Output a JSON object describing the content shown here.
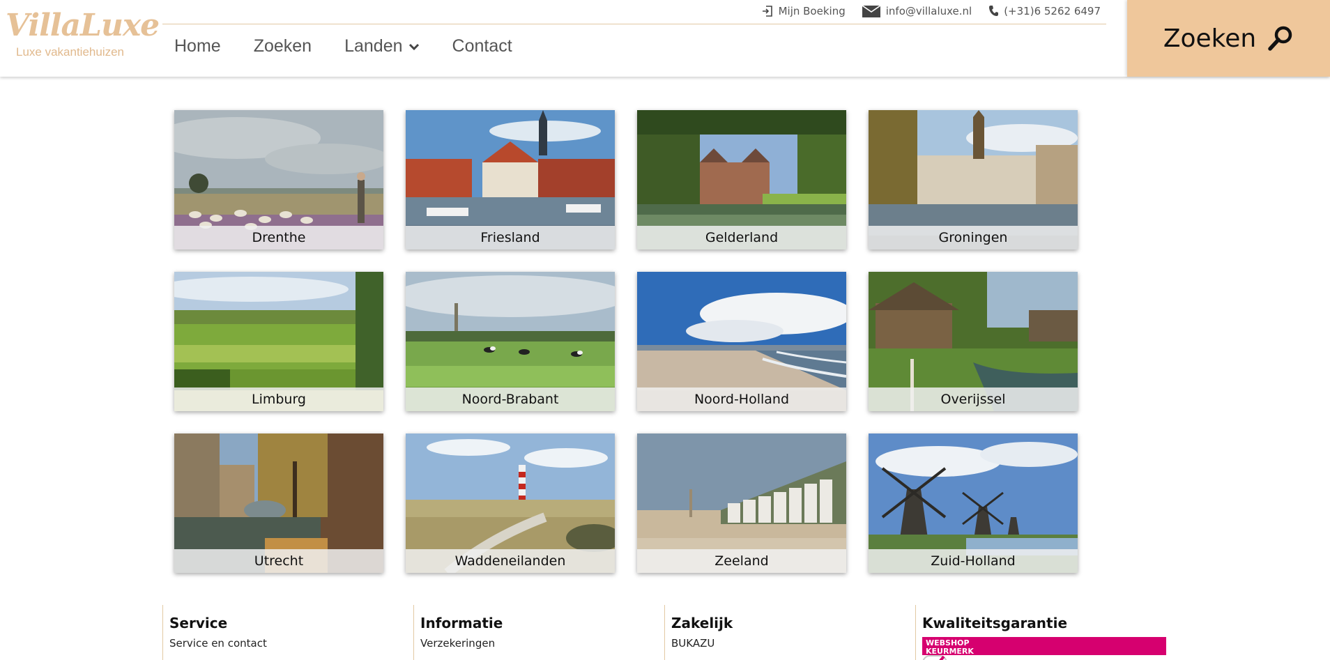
{
  "brand": {
    "logo_text": "VillaLuxe",
    "tagline": "Luxe vakantiehuizen",
    "accent_color": "#efc79b",
    "logo_color": "#e6c197"
  },
  "topbar": {
    "booking": "Mijn Boeking",
    "email": "info@villaluxe.nl",
    "phone": "(+31)6 5262 6497"
  },
  "nav": {
    "items": [
      {
        "label": "Home"
      },
      {
        "label": "Zoeken"
      },
      {
        "label": "Landen"
      },
      {
        "label": "Contact"
      }
    ]
  },
  "search_button": {
    "label": "Zoeken"
  },
  "regions": [
    {
      "label": "Drenthe"
    },
    {
      "label": "Friesland"
    },
    {
      "label": "Gelderland"
    },
    {
      "label": "Groningen"
    },
    {
      "label": "Limburg"
    },
    {
      "label": "Noord-Brabant"
    },
    {
      "label": "Noord-Holland"
    },
    {
      "label": "Overijssel"
    },
    {
      "label": "Utrecht"
    },
    {
      "label": "Waddeneilanden"
    },
    {
      "label": "Zeeland"
    },
    {
      "label": "Zuid-Holland"
    }
  ],
  "footer": {
    "columns": [
      {
        "title": "Service",
        "link": "Service en contact"
      },
      {
        "title": "Informatie",
        "link": "Verzekeringen"
      },
      {
        "title": "Zakelijk",
        "link": "BUKAZU"
      },
      {
        "title": "Kwaliteitsgarantie",
        "badge_line1": "WEBSHOP",
        "badge_line2": "KEURMERK"
      }
    ]
  }
}
